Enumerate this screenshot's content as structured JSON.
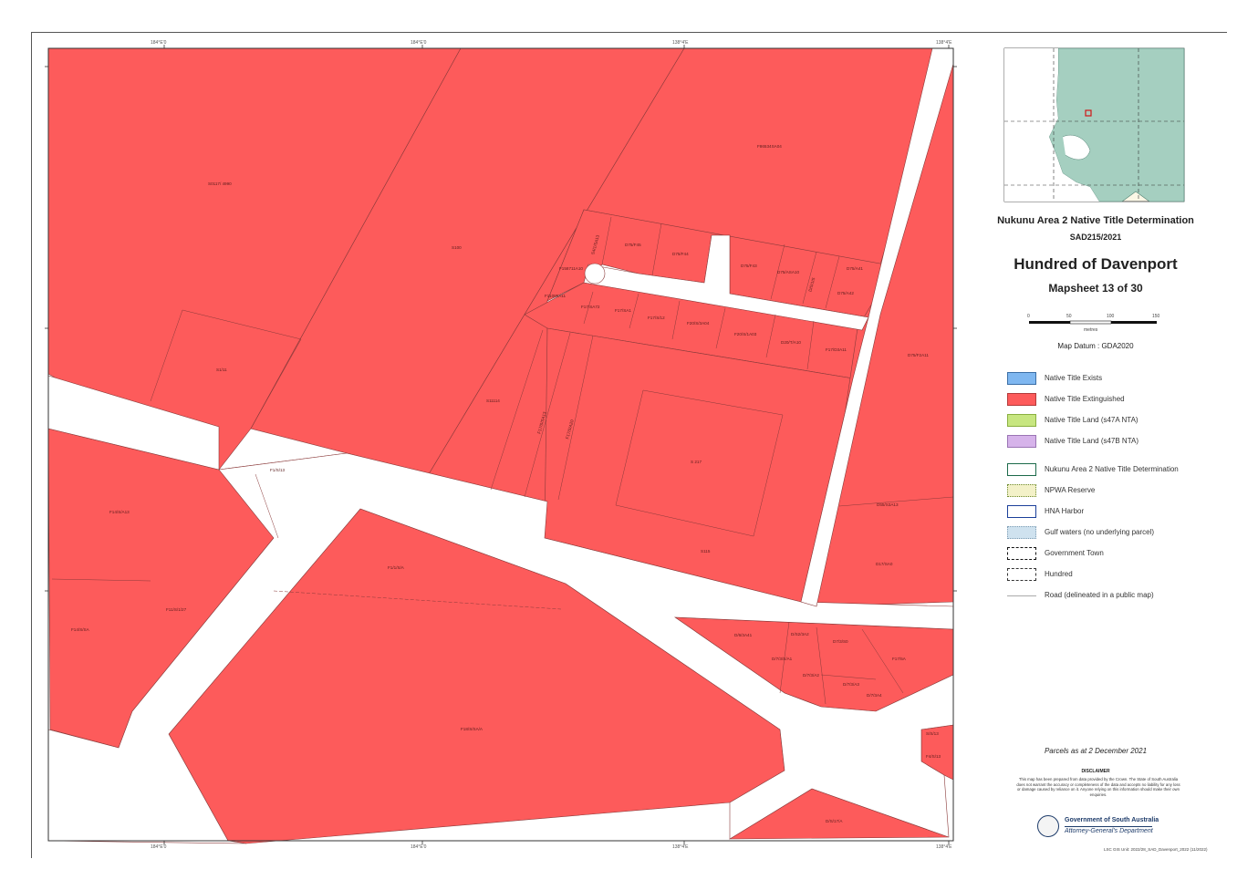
{
  "map": {
    "colors": {
      "native_title_extinguished": "#fd5b5b",
      "road": "#ffffff",
      "parcel_line": "#8a3a3a",
      "inset_land": "#a5cfc0",
      "inset_sea": "#ffffff",
      "inset_paper": "#fbf7e6"
    },
    "grid_ticks_top": [
      "184°E'0",
      "184°E'0",
      "138°4'E",
      "138°4'E"
    ],
    "grid_ticks_bottom": [
      "184°E'0",
      "184°E'0",
      "138°4'E",
      "138°4'E"
    ],
    "grid_ticks_left": [
      "32°S'S",
      "32°S'S",
      "32°S'S"
    ],
    "grid_ticks_right": [
      "32°S'S",
      "32°S'S",
      "32°S'S",
      "32°S'S"
    ],
    "parcel_labels": [
      "S0117/ 4990",
      "S4100",
      "F86534SA04",
      "S100",
      "F158711A10",
      "D75/F45",
      "D75/F44",
      "D75/F43",
      "D75/ASA10",
      "D75/A41",
      "D75/A42",
      "F11085A11",
      "F17/SA72",
      "F17/SA1",
      "F17/S/12",
      "F20/S/3A04",
      "F20/S/1A03",
      "D20/T/A10",
      "F17/D3A11",
      "D75/F2A11",
      "S1/11",
      "S11114",
      "F17/S/SA13",
      "F17/S/A20",
      "S 217",
      "F1/S/13",
      "F14/S/A13",
      "D55/S3A13",
      "S115",
      "F1/1/S/A",
      "F11/S/1/27",
      "D17/SA0",
      "F14/S/SA",
      "D/6/3A41",
      "D/S2/3A2",
      "D7/3/S0",
      "F17/5A",
      "D/7/3/S/A1",
      "D/7/3/A2",
      "D/7/3/A3",
      "D/7/3A4",
      "F18/S/SA/A",
      "S/S/13",
      "F4/S/13",
      "D/S/17/A",
      "S4/1/SA13",
      "D/S/1/S"
    ]
  },
  "title": {
    "project": "Nukunu Area 2 Native Title Determination",
    "case_no": "SAD215/2021",
    "hundred": "Hundred of Davenport",
    "mapsheet": "Mapsheet 13 of 30",
    "datum": "Map Datum : GDA2020"
  },
  "scale_bar": {
    "ticks": [
      "0",
      "50",
      "100",
      "150"
    ],
    "unit": "metres"
  },
  "legend": [
    {
      "label": "Native Title Exists",
      "fill": "#7fb7f0",
      "border": "#3c6fa6",
      "style": "solid"
    },
    {
      "label": "Native Title Extinguished",
      "fill": "#fd5b5b",
      "border": "#b33a3a",
      "style": "solid"
    },
    {
      "label": "Native Title Land (s47A NTA)",
      "fill": "#c7e680",
      "border": "#8ab040",
      "style": "solid"
    },
    {
      "label": "Native Title Land (s47B NTA)",
      "fill": "#d6b3ea",
      "border": "#9a74b4",
      "style": "solid"
    },
    {
      "label": "Nukunu Area 2 Native Title Determination",
      "fill": "#ffffff",
      "border": "#1c6a4a",
      "style": "solid"
    },
    {
      "label": "NPWA Reserve",
      "fill": "#f3f1c8",
      "border": "#6d8a2f",
      "style": "dotted"
    },
    {
      "label": "HNA Harbor",
      "fill": "#ffffff",
      "border": "#1b3f9a",
      "style": "solid"
    },
    {
      "label": "Gulf waters (no underlying parcel)",
      "fill": "#cfe2ef",
      "border": "#7e9cb3",
      "style": "dotted"
    },
    {
      "label": "Government Town",
      "fill": "#ffffff",
      "border": "#111111",
      "style": "dashed"
    },
    {
      "label": "Hundred",
      "fill": "#ffffff",
      "border": "#333333",
      "style": "dashed"
    },
    {
      "label": "Road (delineated in a public map)",
      "fill": "none",
      "border": "#aaaaaa",
      "style": "line"
    }
  ],
  "parcels_date": "Parcels as at 2 December 2021",
  "disclaimer": {
    "heading": "DISCLAIMER",
    "text": "This map has been prepared from data provided by the Crown. The State of South Australia does not warrant the accuracy or completeness of the data and accepts no liability for any loss or damage caused by reliance on it. Anyone relying on this information should make their own enquiries."
  },
  "government": {
    "name": "Government of South Australia",
    "department": "Attorney-General's Department"
  },
  "footer_ref": "LSC GIS Unit: 2022/28_SAD_Davenport_2022 (11/2022)"
}
